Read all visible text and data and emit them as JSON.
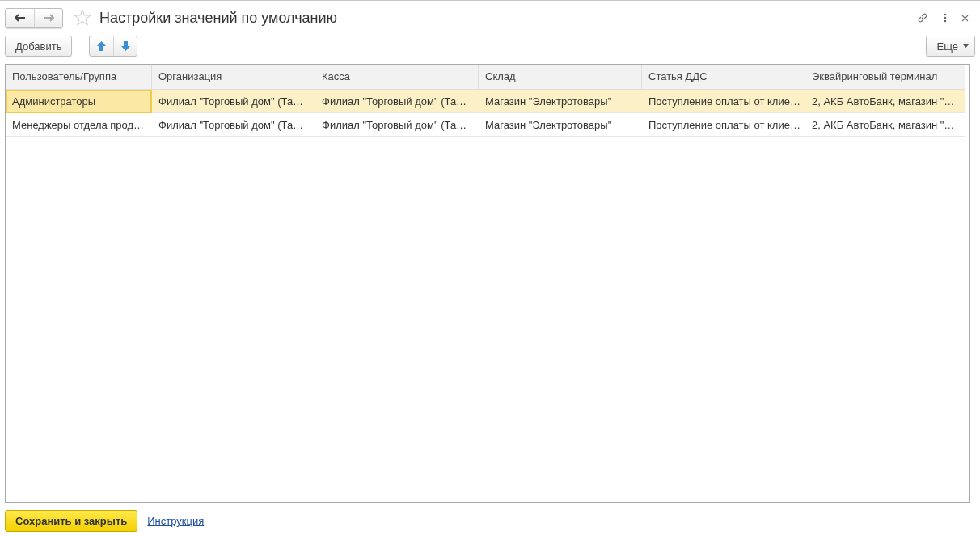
{
  "window": {
    "title": "Настройки значений по умолчанию",
    "favorite": false
  },
  "toolbar": {
    "add_button": "Добавить",
    "more_button": "Еще"
  },
  "table": {
    "columns": [
      "Пользователь/Группа",
      "Организация",
      "Касса",
      "Склад",
      "Статья ДДС",
      "Эквайринговый терминал"
    ],
    "rows": [
      {
        "selected": true,
        "cells": [
          "Администраторы",
          "Филиал \"Торговый дом\" (Та…",
          "Филиал \"Торговый дом\" (Та…",
          "Магазин \"Электротовары\"",
          "Поступление оплаты от клие…",
          "2, АКБ АвтоБанк, магазин \"…"
        ]
      },
      {
        "selected": false,
        "cells": [
          "Менеджеры отдела прод…",
          "Филиал \"Торговый дом\" (Та…",
          "Филиал \"Торговый дом\" (Та…",
          "Магазин \"Электротовары\"",
          "Поступление оплаты от клие…",
          "2, АКБ АвтоБанк, магазин \"…"
        ]
      }
    ]
  },
  "footer": {
    "save_button": "Сохранить и закрыть",
    "help_link": "Инструкция"
  }
}
